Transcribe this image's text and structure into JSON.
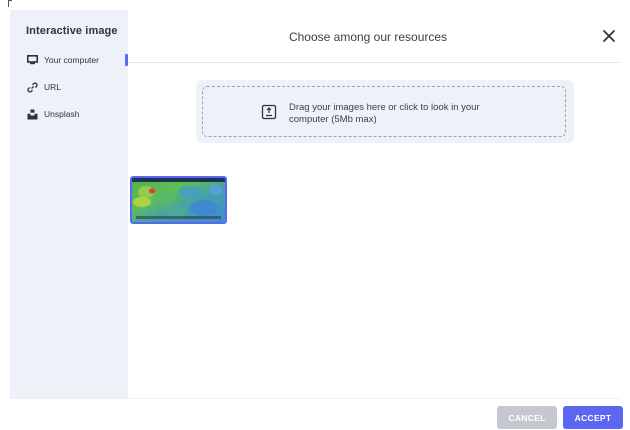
{
  "sidebar": {
    "title": "Interactive image",
    "items": [
      {
        "label": "Your computer",
        "icon": "monitor-icon",
        "active": true
      },
      {
        "label": "URL",
        "icon": "link-icon",
        "active": false
      },
      {
        "label": "Unsplash",
        "icon": "unsplash-icon",
        "active": false
      }
    ]
  },
  "header": {
    "title": "Choose among our resources",
    "close_icon": "close-icon"
  },
  "dropzone": {
    "line1": "Drag your images here or click to look in your",
    "line2": "computer (5Mb max)",
    "icon": "upload-icon"
  },
  "thumbnails": [
    {
      "selected": true,
      "alt": "weather map thumbnail"
    }
  ],
  "footer": {
    "cancel_label": "CANCEL",
    "accept_label": "ACCEPT"
  },
  "colors": {
    "accent": "#5b67f1",
    "sidebar_bg": "#eef1f7",
    "cancel_bg": "#c5c8d1",
    "text": "#3a3f4c"
  }
}
